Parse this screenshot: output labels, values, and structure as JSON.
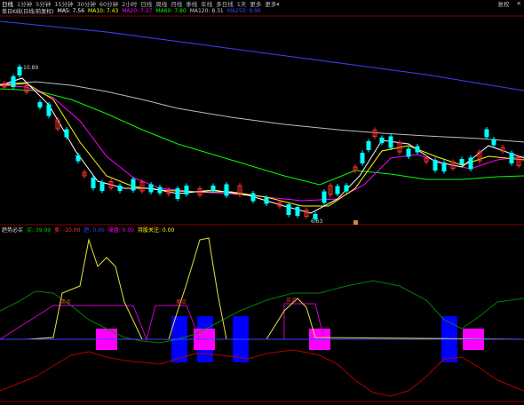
{
  "toolbar": {
    "items": [
      "日线",
      "1分钟",
      "5分钟",
      "15分钟",
      "30分钟",
      "60分钟",
      "2小时",
      "日线",
      "周线",
      "月线",
      "季线",
      "年线",
      "多日线",
      "1天",
      "更多",
      "更多▾"
    ],
    "right": "复权",
    "close": "✕"
  },
  "main_legend": {
    "name": "单日K线(日线/前复权)",
    "indicators": [
      {
        "text": "MA5: 7.56",
        "color": "#ffffff"
      },
      {
        "text": "MA10: 7.43",
        "color": "#ffff00"
      },
      {
        "text": "MA20: 7.37",
        "color": "#ff00ff"
      },
      {
        "text": "MA60: 7.80",
        "color": "#00ff00"
      },
      {
        "text": "MA120: 8.31",
        "color": "#cccccc"
      },
      {
        "text": "MA250: 9.96",
        "color": "#4040ff"
      }
    ]
  },
  "sub_legend": {
    "name": "趋势必买",
    "indicators": [
      {
        "text": "买: 39.99",
        "color": "#00cc00"
      },
      {
        "text": "卖: -10.00",
        "color": "#ff4040"
      },
      {
        "text": "趋: 0.00",
        "color": "#4040ff"
      },
      {
        "text": "操盘: 0.00",
        "color": "#ff00ff"
      },
      {
        "text": "持股关注: 0.00",
        "color": "#ffff00"
      }
    ]
  },
  "labels": {
    "high": "10.89",
    "low": "6.63",
    "sub_marks": [
      "买点",
      "卖点",
      "买点"
    ]
  },
  "colors": {
    "bg": "#000000",
    "up": "#ff3030",
    "down": "#00ffff",
    "grid": "#800000",
    "ma5": "#ffffff",
    "ma10": "#ffff00",
    "ma20": "#ff00ff",
    "ma60": "#00ff00",
    "ma120": "#bbbbbb",
    "ma250": "#4040ff"
  }
}
